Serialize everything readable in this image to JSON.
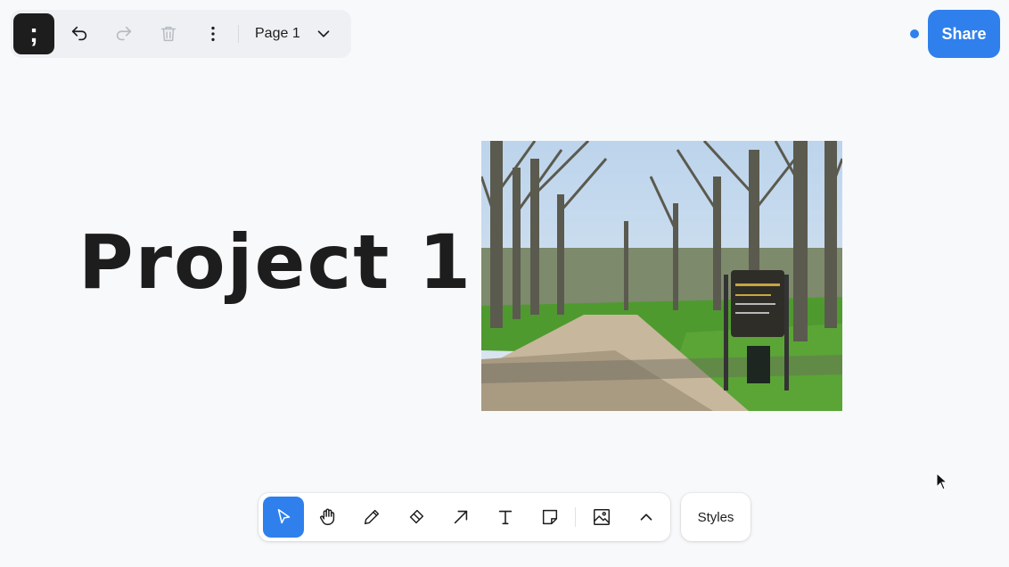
{
  "top_bar": {
    "logo_glyph": ";",
    "page_label": "Page 1",
    "icons": [
      "menu-logo-icon",
      "undo-icon",
      "redo-icon",
      "trash-icon",
      "more-vertical-icon",
      "chevron-down-icon"
    ]
  },
  "share": {
    "label": "Share",
    "accent": "#2f80ed"
  },
  "canvas": {
    "title": "Project 1",
    "image_subject": "park-photo"
  },
  "bottom_toolbar": {
    "tools": [
      "select-icon",
      "hand-icon",
      "pencil-icon",
      "eraser-icon",
      "arrow-icon",
      "text-icon",
      "sticky-note-icon",
      "image-icon",
      "chevron-up-icon"
    ],
    "active_tool": "select-icon",
    "styles_label": "Styles"
  }
}
